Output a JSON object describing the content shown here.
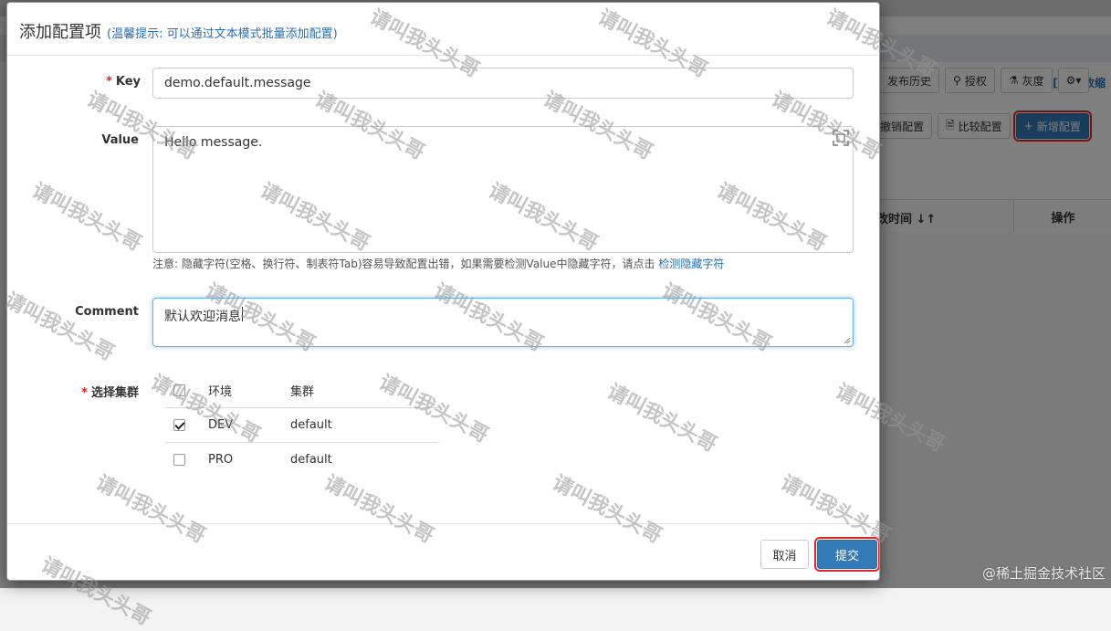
{
  "background": {
    "toggle_link": "[展开/收缩",
    "toolbar1": [
      "发布历史",
      "授权",
      "灰度"
    ],
    "toolbar2": [
      "撤销配置",
      "比较配置",
      "新增配置"
    ],
    "table_head": {
      "col_time": "改时间 ↓↑",
      "col_action": "操作"
    }
  },
  "modal": {
    "title": "添加配置项",
    "tip": "(温馨提示: 可以通过文本模式批量添加配置)",
    "key": {
      "label": "Key",
      "value": "demo.default.message"
    },
    "value": {
      "label": "Value",
      "value": "Hello message."
    },
    "note": {
      "text": "注意: 隐藏字符(空格、换行符、制表符Tab)容易导致配置出错，如果需要检测Value中隐藏字符，请点击 ",
      "link": "检测隐藏字符"
    },
    "comment": {
      "label": "Comment",
      "value": "默认欢迎消息"
    },
    "cluster": {
      "label": "选择集群",
      "headers": [
        "环境",
        "集群"
      ],
      "rows": [
        {
          "env": "DEV",
          "cluster": "default",
          "checked": true
        },
        {
          "env": "PRO",
          "cluster": "default",
          "checked": false
        }
      ]
    },
    "footer": {
      "cancel": "取消",
      "submit": "提交"
    }
  },
  "watermark": "请叫我头头哥",
  "site_watermark": "@稀土掘金技术社区"
}
